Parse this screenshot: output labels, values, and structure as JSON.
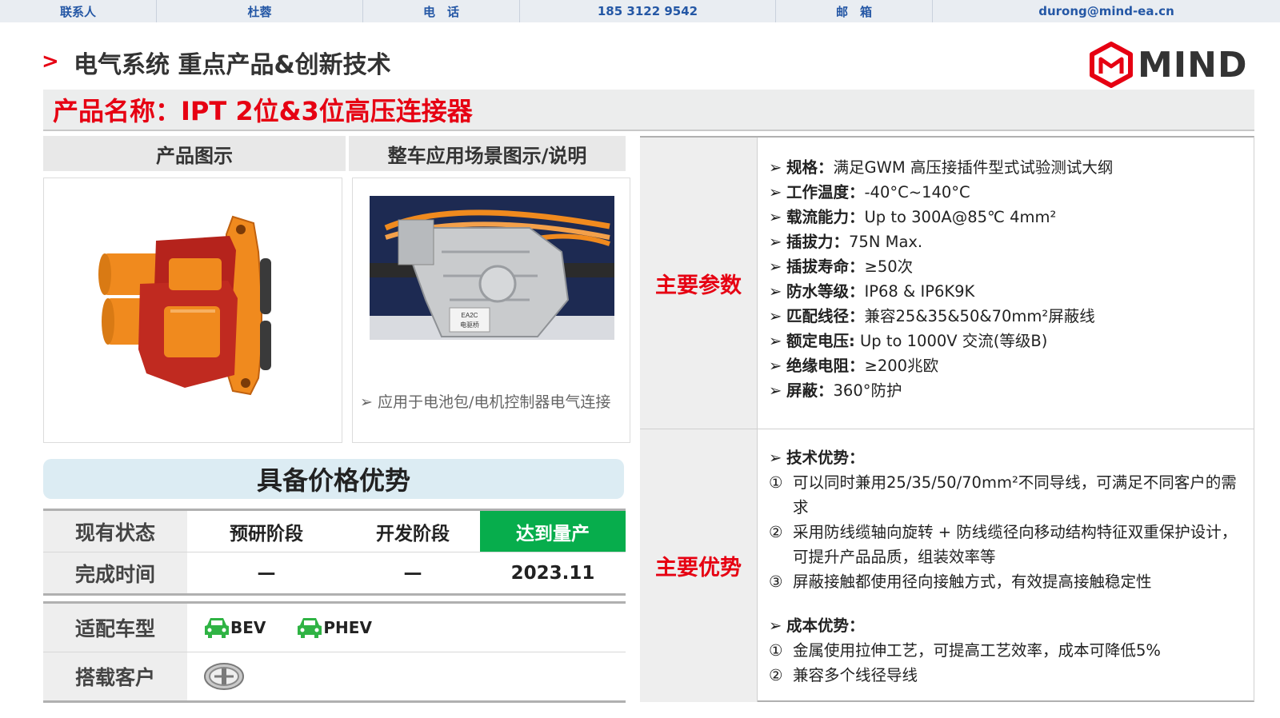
{
  "contact": {
    "contact_label": "联系人",
    "contact_name": "杜蓉",
    "phone_label": "电　话",
    "phone": "185 3122 9542",
    "email_label": "邮　箱",
    "email": "durong@mind-ea.cn"
  },
  "header": {
    "section_title": "电气系统 重点产品&创新技术",
    "logo_text": "MIND",
    "product_name": "产品名称：IPT 2位&3位高压连接器"
  },
  "columns": {
    "product_image": "产品图示",
    "scene_image": "整车应用场景图示/说明"
  },
  "scene": {
    "caption": "应用于电池包/电机控制器电气连接",
    "photo_label_1": "EA2C",
    "photo_label_2": "电驱桥"
  },
  "advantage_banner": "具备价格优势",
  "status": {
    "row1_label": "现有状态",
    "stage1": "预研阶段",
    "stage2": "开发阶段",
    "stage3": "达到量产",
    "row2_label": "完成时间",
    "time1": "—",
    "time2": "—",
    "time3": "2023.11"
  },
  "vehicle": {
    "type_label": "适配车型",
    "bev": "BEV",
    "phev": "PHEV",
    "customer_label": "搭载客户"
  },
  "params": {
    "label": "主要参数",
    "items": [
      {
        "k": "规格：",
        "v": "满足GWM 高压接插件型式试验测试大纲"
      },
      {
        "k": "工作温度：",
        "v": "-40°C~140°C"
      },
      {
        "k": "载流能力：",
        "v": "Up to 300A@85℃  4mm²"
      },
      {
        "k": "插拔力：",
        "v": "75N Max."
      },
      {
        "k": "插拔寿命：",
        "v": "≥50次"
      },
      {
        "k": "防水等级：",
        "v": "IP68 & IP6K9K"
      },
      {
        "k": "匹配线径：",
        "v": "兼容25&35&50&70mm²屏蔽线"
      },
      {
        "k": "额定电压:",
        "v": " Up to 1000V 交流(等级B)"
      },
      {
        "k": "绝缘电阻：",
        "v": "≥200兆欧"
      },
      {
        "k": "屏蔽：",
        "v": "360°防护"
      }
    ]
  },
  "advantages": {
    "label": "主要优势",
    "tech_head": "技术优势：",
    "tech": [
      {
        "n": "①",
        "t": "可以同时兼用25/35/50/70mm²不同导线，可满足不同客户的需求"
      },
      {
        "n": "②",
        "t": "采用防线缆轴向旋转 + 防线缆径向移动结构特征双重保护设计，可提升产品品质，组装效率等"
      },
      {
        "n": "③",
        "t": "屏蔽接触都使用径向接触方式，有效提高接触稳定性"
      }
    ],
    "cost_head": "成本优势：",
    "cost": [
      {
        "n": "①",
        "t": "金属使用拉伸工艺，可提高工艺效率，成本可降低5%"
      },
      {
        "n": "②",
        "t": "兼容多个线径导线"
      }
    ]
  },
  "colors": {
    "accent_red": "#e60012",
    "contact_blue": "#2457a5",
    "mass_production_green": "#07ad4c",
    "connector_orange": "#f08a1e",
    "car_icon_green": "#2fb344"
  }
}
